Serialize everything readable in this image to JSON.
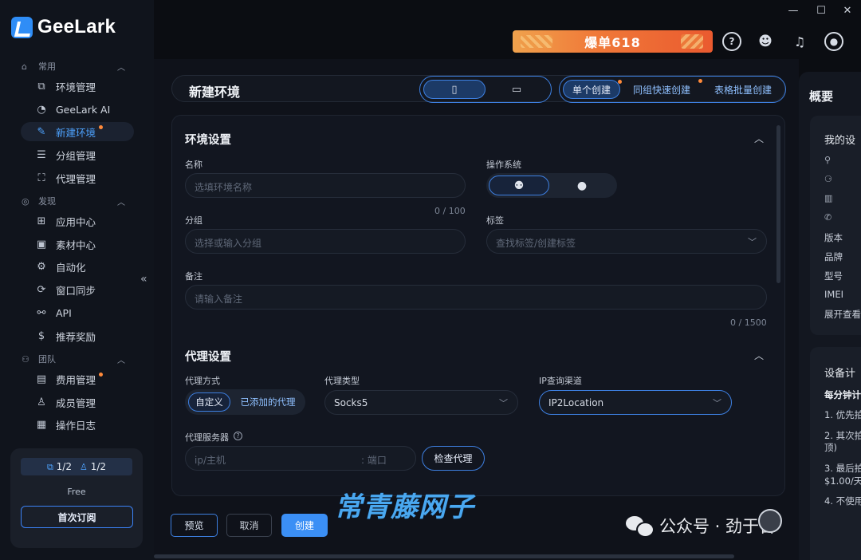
{
  "app": {
    "name": "GeeLark"
  },
  "window_controls": {
    "minimize": "—",
    "maximize": "☐",
    "close": "✕"
  },
  "promo": {
    "text": "爆单618"
  },
  "sidebar": {
    "sections": [
      {
        "label": "常用",
        "items": [
          "环境管理",
          "GeeLark AI",
          "新建环境",
          "分组管理",
          "代理管理"
        ]
      },
      {
        "label": "发现",
        "items": [
          "应用中心",
          "素材中心",
          "自动化",
          "窗口同步",
          "API",
          "推荐奖励"
        ]
      },
      {
        "label": "团队",
        "items": [
          "费用管理",
          "成员管理",
          "操作日志"
        ]
      }
    ],
    "active_item": "新建环境",
    "plan": {
      "devices": "1/2",
      "members": "1/2",
      "tier": "Free",
      "subscribe_label": "首次订阅"
    }
  },
  "header": {
    "title": "新建环境",
    "modes": [
      "单个创建",
      "同组快速创建",
      "表格批量创建"
    ],
    "active_mode": "单个创建"
  },
  "env_settings": {
    "title": "环境设置",
    "name": {
      "label": "名称",
      "placeholder": "选填环境名称",
      "counter": "0 / 100"
    },
    "os": {
      "label": "操作系统",
      "selected": "android"
    },
    "group": {
      "label": "分组",
      "placeholder": "选择或输入分组"
    },
    "tags": {
      "label": "标签",
      "placeholder": "查找标签/创建标签"
    },
    "remark": {
      "label": "备注",
      "placeholder": "请输入备注",
      "counter": "0 / 1500"
    }
  },
  "proxy_settings": {
    "title": "代理设置",
    "mode": {
      "label": "代理方式",
      "options": [
        "自定义",
        "已添加的代理"
      ],
      "selected": "自定义"
    },
    "type": {
      "label": "代理类型",
      "value": "Socks5"
    },
    "ip_channel": {
      "label": "IP查询渠道",
      "value": "IP2Location"
    },
    "server": {
      "label": "代理服务器",
      "host_placeholder": "ip/主机",
      "port_placeholder": ": 端口",
      "check_label": "检查代理"
    }
  },
  "footer": {
    "preview": "预览",
    "cancel": "取消",
    "create": "创建"
  },
  "overview": {
    "title": "概要",
    "my_device": "我的设",
    "rows": [
      "版本",
      "品牌",
      "型号",
      "IMEI",
      "展开查看"
    ],
    "billing_title": "设备计",
    "billing_sub": "每分钟计",
    "billing_items": [
      "1. 优先拍",
      "2. 其次拍",
      "顶)",
      "3. 最后拍",
      "$1.00/天",
      "4. 不使用"
    ]
  },
  "watermark": {
    "handwritten": "常青藤网子",
    "wechat": "公众号 · 劲于奋"
  },
  "colors": {
    "accent": "#3b8ff5",
    "promo": "#f07a39",
    "badge": "#ff8a3a"
  }
}
